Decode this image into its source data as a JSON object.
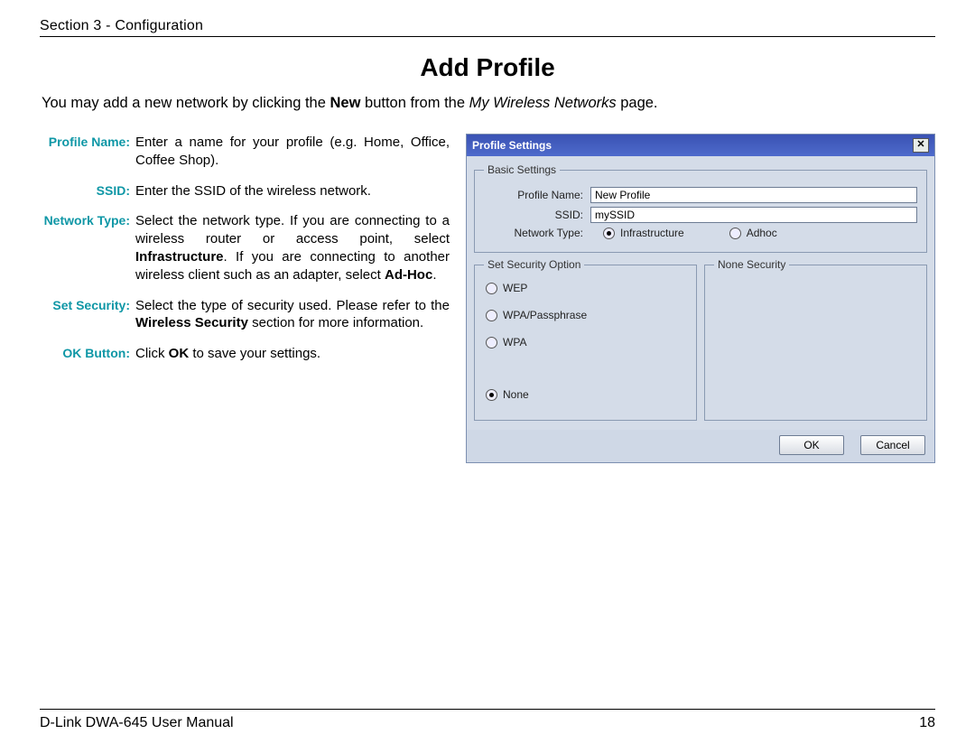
{
  "header": {
    "section": "Section 3 - Configuration"
  },
  "title": "Add Profile",
  "intro": {
    "pre": "You may add a new network by clicking the ",
    "bold": "New",
    "mid": " button from the ",
    "ital": "My Wireless Networks",
    "post": " page."
  },
  "defs": [
    {
      "term": "Profile Name:",
      "desc": "Enter a name for your profile (e.g. Home, Office, Coffee Shop)."
    },
    {
      "term": "SSID:",
      "desc": "Enter the SSID of the wireless network."
    },
    {
      "term": "Network Type:",
      "desc_html": "Select the network type. If you are connecting to a wireless router or access point, select <b>Infrastructure</b>. If you are connecting to another wireless client such as an adapter, select <b>Ad-Hoc</b>."
    },
    {
      "term": "Set Security:",
      "desc_html": "Select the type of security used. Please refer to the <b>Wireless Security</b> section for more information."
    },
    {
      "term": "OK Button:",
      "desc_html": "Click <b>OK</b> to save your settings."
    }
  ],
  "dialog": {
    "title": "Profile Settings",
    "basic_legend": "Basic Settings",
    "profile_name_label": "Profile Name:",
    "profile_name_value": "New Profile",
    "ssid_label": "SSID:",
    "ssid_value": "mySSID",
    "network_type_label": "Network Type:",
    "radio_infra": "Infrastructure",
    "radio_adhoc": "Adhoc",
    "security_legend": "Set Security Option",
    "none_legend": "None Security",
    "sec_options": [
      "WEP",
      "WPA/Passphrase",
      "WPA",
      "None"
    ],
    "sec_selected_index": 3,
    "ok": "OK",
    "cancel": "Cancel"
  },
  "footer": {
    "left": "D-Link DWA-645 User Manual",
    "right": "18"
  }
}
